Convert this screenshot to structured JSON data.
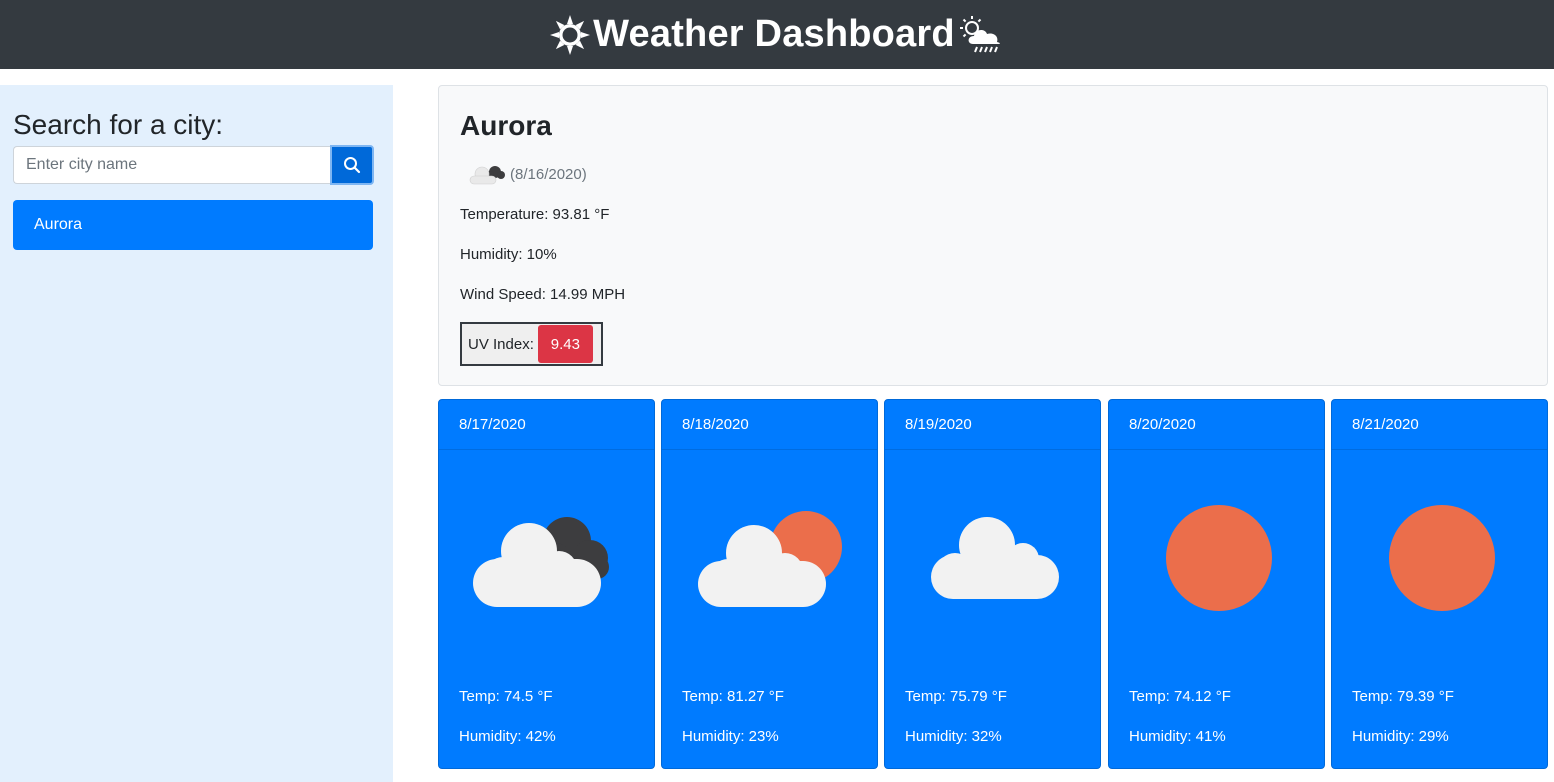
{
  "header": {
    "title": "Weather Dashboard",
    "left_icon": "sun-icon",
    "right_icon": "sun-cloud-rain-icon"
  },
  "sidebar": {
    "title": "Search for a city:",
    "search": {
      "placeholder": "Enter city name",
      "value": "",
      "button_icon": "search-icon"
    },
    "history": [
      {
        "label": "Aurora"
      }
    ]
  },
  "current": {
    "city": "Aurora",
    "icon": "cloudy-icon",
    "date": "(8/16/2020)",
    "temperature": "Temperature: 93.81 °F",
    "humidity": "Humidity: 10%",
    "wind": "Wind Speed: 14.99 MPH",
    "uv_label": "UV Index:",
    "uv_value": "9.43",
    "uv_color": "#dc3545"
  },
  "forecast": [
    {
      "date": "8/17/2020",
      "icon": "broken-clouds-icon",
      "temp": "Temp: 74.5 °F",
      "humidity": "Humidity: 42%"
    },
    {
      "date": "8/18/2020",
      "icon": "few-clouds-icon",
      "temp": "Temp: 81.27 °F",
      "humidity": "Humidity: 23%"
    },
    {
      "date": "8/19/2020",
      "icon": "scattered-clouds-icon",
      "temp": "Temp: 75.79 °F",
      "humidity": "Humidity: 32%"
    },
    {
      "date": "8/20/2020",
      "icon": "clear-sky-icon",
      "temp": "Temp: 74.12 °F",
      "humidity": "Humidity: 41%"
    },
    {
      "date": "8/21/2020",
      "icon": "clear-sky-icon",
      "temp": "Temp: 79.39 °F",
      "humidity": "Humidity: 29%"
    }
  ],
  "colors": {
    "header_bg": "#343a40",
    "accent": "#007bff",
    "sidebar_bg": "#e3f0fd",
    "sun": "#eb6e4b",
    "cloud": "#f2f2f2",
    "dark_cloud": "#3d3d3f"
  }
}
